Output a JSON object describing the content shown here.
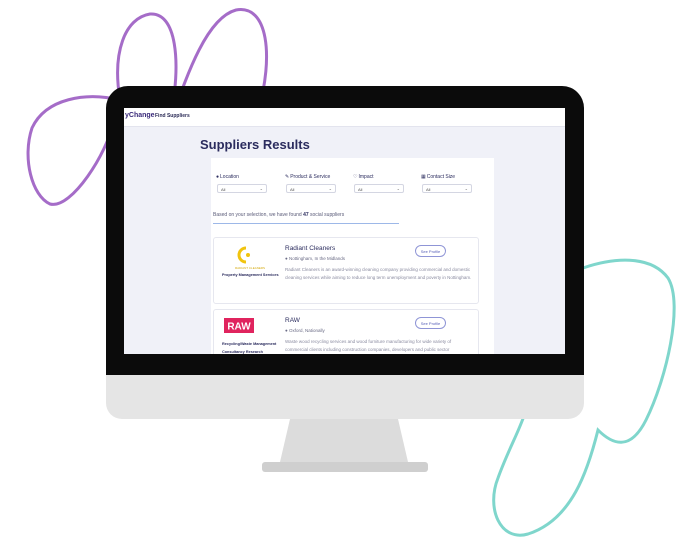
{
  "app": {
    "brand": "yChange",
    "nav_link": "Find Suppliers"
  },
  "page": {
    "title": "Suppliers Results"
  },
  "filters": [
    {
      "label": "Location",
      "icon": "map-pin-icon",
      "value": "All"
    },
    {
      "label": "Product & Service",
      "icon": "wrench-icon",
      "value": "All"
    },
    {
      "label": "Impact",
      "icon": "heart-icon",
      "value": "All"
    },
    {
      "label": "Contact Size",
      "icon": "grid-icon",
      "value": "All"
    }
  ],
  "results": {
    "prefix": "Based on your selection, we have found ",
    "count": "47",
    "suffix": " social suppliers"
  },
  "suppliers": [
    {
      "name": "Radiant Cleaners",
      "location": "Nottingham, In the Midlands",
      "category": "Property Management Services",
      "logo_text": "RADIANT CLEANERS",
      "description": "Radiant Cleaners is an award-winning cleaning company providing commercial and domestic cleaning services while aiming to reduce long term unemployment and poverty in Nottingham.",
      "button": "See Profile"
    },
    {
      "name": "RAW",
      "location": "Oxford, Nationally",
      "category": "Recycling/Waste Management Consultancy Research",
      "logo_text": "RAW",
      "description": "Waste wood recycling services and wood furniture manufacturing for wide variety of commercial clients including construction companies, developers and public sector",
      "button": "See Profile"
    }
  ],
  "colors": {
    "purple_doodle": "#a56cc8",
    "teal_doodle": "#7fd6cc",
    "title": "#2b2c5e",
    "raw_logo": "#e0245e",
    "radiant_logo": "#f1c40f"
  }
}
